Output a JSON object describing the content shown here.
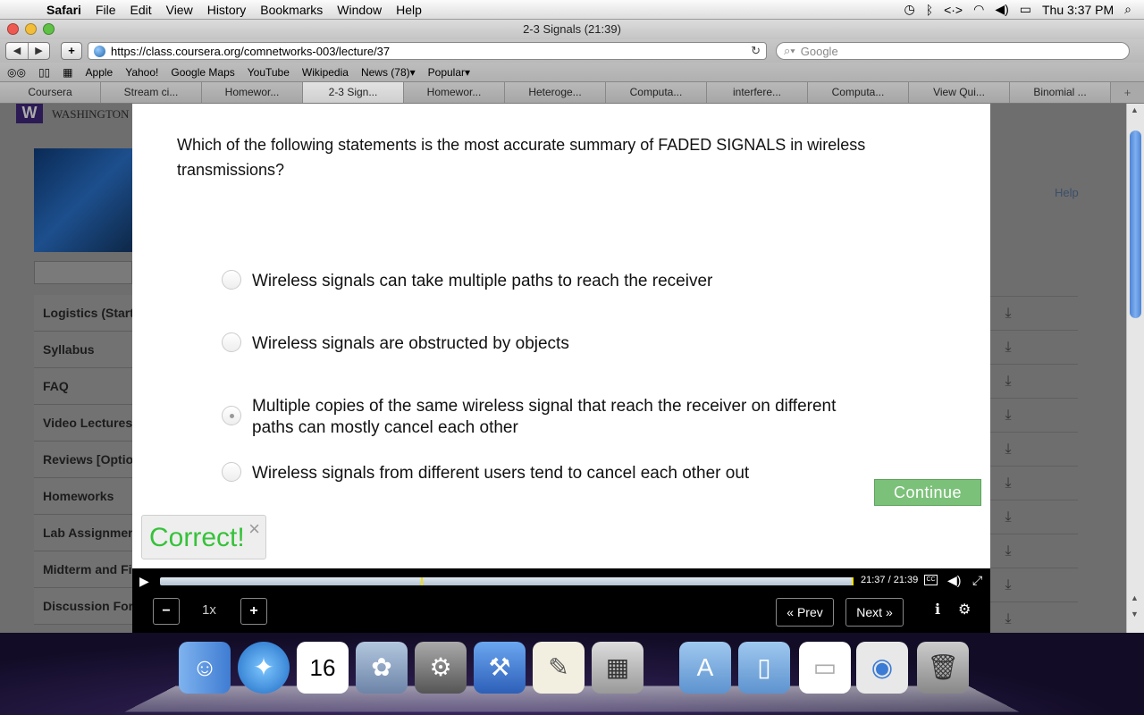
{
  "menubar": {
    "app": "Safari",
    "items": [
      "File",
      "Edit",
      "View",
      "History",
      "Bookmarks",
      "Window",
      "Help"
    ],
    "clock": "Thu 3:37 PM"
  },
  "window": {
    "title": "2-3 Signals (21:39)"
  },
  "toolbar": {
    "url": "https://class.coursera.org/comnetworks-003/lecture/37",
    "search_placeholder": "Google"
  },
  "bookmarks": [
    "Apple",
    "Yahoo!",
    "Google Maps",
    "YouTube",
    "Wikipedia",
    "News (78)▾",
    "Popular▾"
  ],
  "tabs": [
    {
      "label": "Coursera"
    },
    {
      "label": "Stream ci..."
    },
    {
      "label": "Homewor..."
    },
    {
      "label": "2-3 Sign...",
      "active": true
    },
    {
      "label": "Homewor..."
    },
    {
      "label": "Heteroge..."
    },
    {
      "label": "Computa..."
    },
    {
      "label": "interfere..."
    },
    {
      "label": "Computa..."
    },
    {
      "label": "View Qui..."
    },
    {
      "label": "Binomial ..."
    }
  ],
  "page": {
    "logo_text": "WASHINGTON",
    "help": "Help",
    "sidenav": [
      "Logistics (Start",
      "Syllabus",
      "FAQ",
      "Video Lectures",
      "Reviews [Optio",
      "Homeworks",
      "Lab Assignmen",
      "Midterm and Fi",
      "Discussion For"
    ]
  },
  "quiz": {
    "question": "Which of the following statements is the most accurate summary of FADED SIGNALS in wireless transmissions?",
    "options": [
      "Wireless signals can take multiple paths to reach the receiver",
      "Wireless signals are obstructed by objects",
      "Multiple copies of the same wireless signal that reach the receiver on different paths can mostly cancel each other",
      "Wireless signals from different users tend to cancel each other out"
    ],
    "selected_index": 2,
    "continue_label": "Continue",
    "feedback": "Correct!",
    "close_symbol": "×"
  },
  "player": {
    "time": "21:37 / 21:39",
    "progress": 1.0,
    "quiz_marker": 0.376,
    "speed": "1x",
    "minus": "−",
    "plus": "+",
    "prev_label": "« Prev",
    "next_label": "Next »",
    "cc_label": "CC"
  },
  "colors": {
    "continue_bg": "#7cc17a",
    "correct_text": "#36c23a",
    "marker": "#f3e000"
  }
}
